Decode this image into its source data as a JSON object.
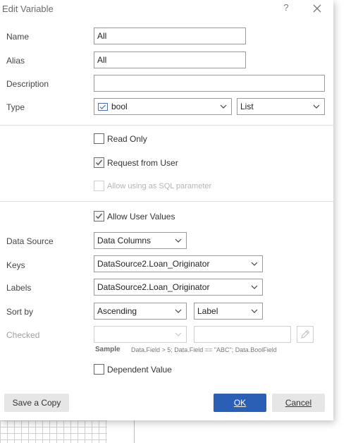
{
  "dialog": {
    "title": "Edit Variable",
    "help_label": "?",
    "close_icon": "close-icon"
  },
  "fields": {
    "name_label": "Name",
    "name_value": "All",
    "alias_label": "Alias",
    "alias_value": "All",
    "description_label": "Description",
    "description_value": "",
    "type_label": "Type",
    "type_icon": "bool-type-icon",
    "type_value": "bool",
    "type_kind_value": "List"
  },
  "options": {
    "read_only_label": "Read Only",
    "read_only_checked": false,
    "request_from_user_label": "Request from User",
    "request_from_user_checked": true,
    "allow_sql_label": "Allow using as SQL parameter",
    "allow_sql_checked": false,
    "allow_sql_enabled": false
  },
  "list": {
    "allow_user_values_label": "Allow User Values",
    "allow_user_values_checked": true,
    "data_source_label": "Data Source",
    "data_source_value": "Data Columns",
    "keys_label": "Keys",
    "keys_value": "DataSource2.Loan_Originator",
    "labels_label": "Labels",
    "labels_value": "DataSource2.Loan_Originator",
    "sort_by_label": "Sort by",
    "sort_order_value": "Ascending",
    "sort_field_value": "Label",
    "checked_label": "Checked",
    "checked_select_value": "",
    "checked_text_value": "",
    "sample_label": "Sample",
    "sample_text": "Data.Field > 5; Data.Field == \"ABC\"; Data.BoolField",
    "dependent_value_label": "Dependent Value",
    "dependent_value_checked": false
  },
  "buttons": {
    "save_copy_label": "Save a Copy",
    "ok_label": "OK",
    "cancel_label": "Cancel"
  },
  "colors": {
    "primary_button": "#2b5fb6",
    "secondary_button": "#e6e6e6"
  }
}
